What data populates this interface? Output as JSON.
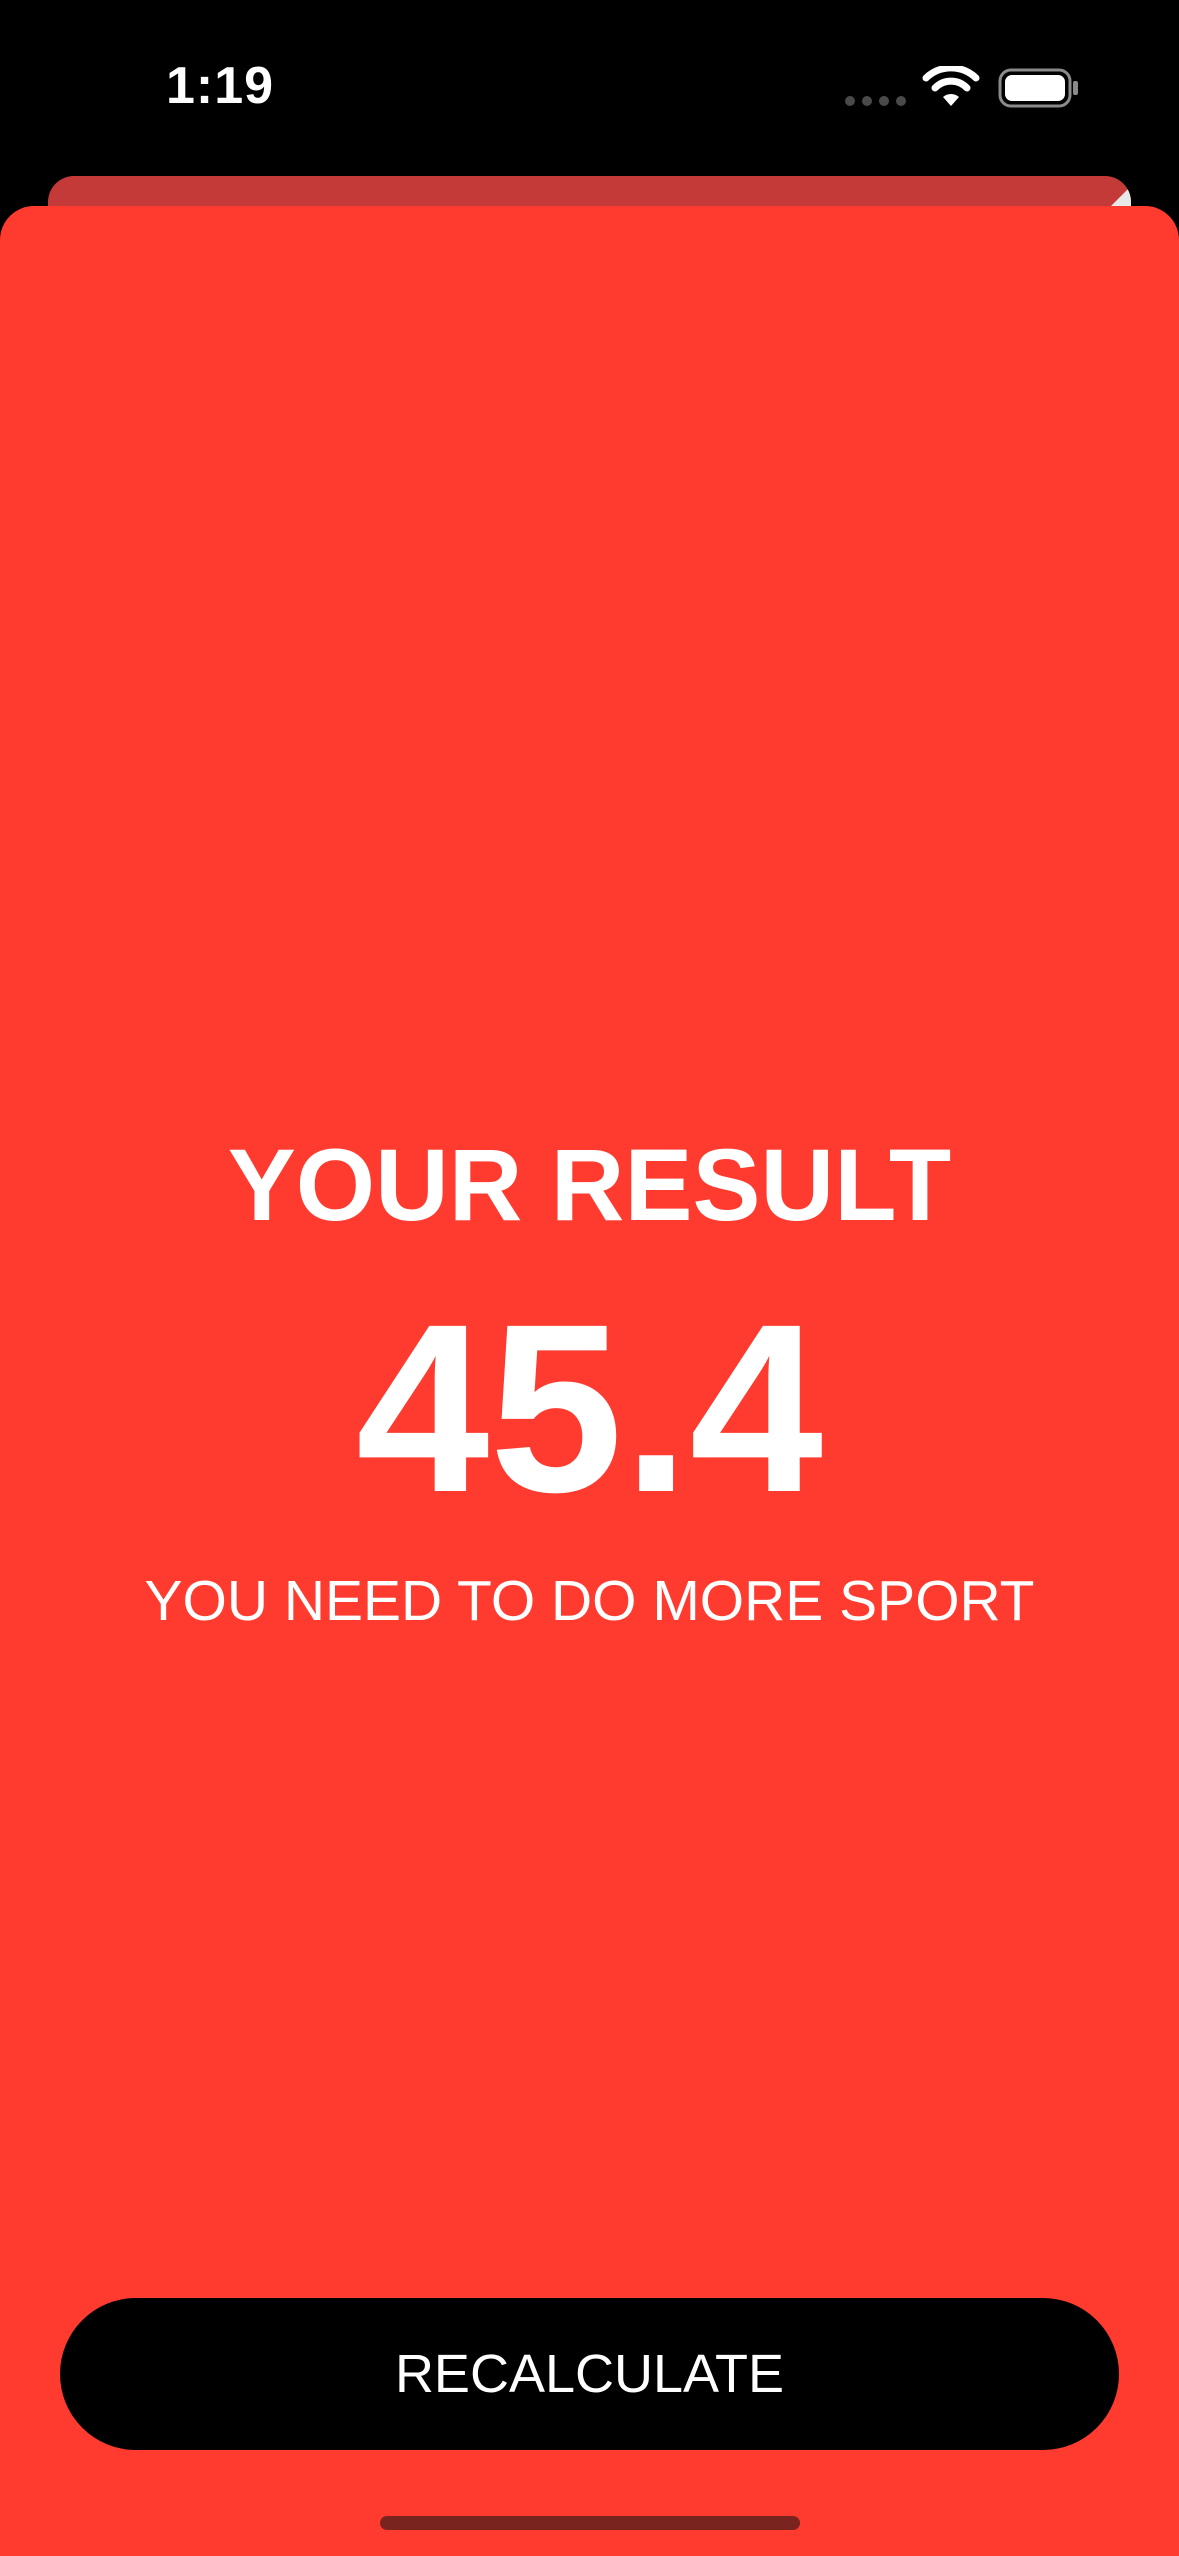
{
  "status_bar": {
    "time": "1:19"
  },
  "colors": {
    "sheet_background": "#ff3b30",
    "button_background": "#000000",
    "text": "#ffffff"
  },
  "result": {
    "title": "YOUR RESULT",
    "value": "45.4",
    "advice": "YOU NEED TO DO MORE SPORT"
  },
  "actions": {
    "recalculate_label": "RECALCULATE"
  }
}
